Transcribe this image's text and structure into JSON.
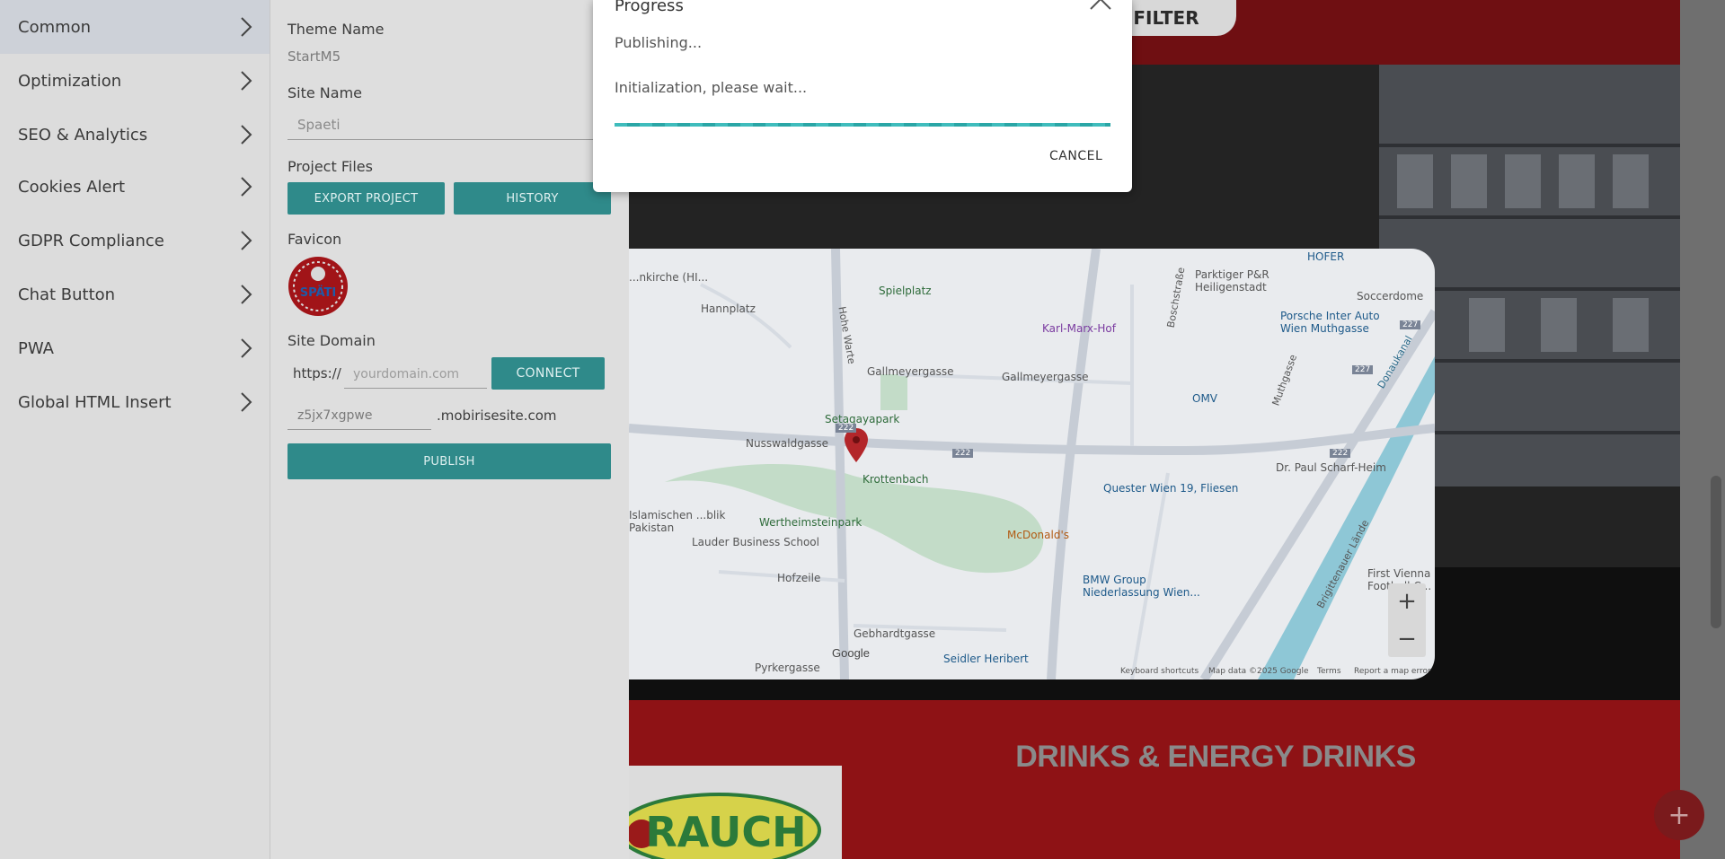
{
  "colors": {
    "accent": "#2f8a8a",
    "progress": "#3fbcbc",
    "brand_red": "#c3181d"
  },
  "sidebar": {
    "items": [
      {
        "label": "Common",
        "icon": "chevron-right-icon"
      },
      {
        "label": "Optimization",
        "icon": "chevron-right-icon"
      },
      {
        "label": "SEO & Analytics",
        "icon": "chevron-right-icon"
      },
      {
        "label": "Cookies Alert",
        "icon": "chevron-right-icon"
      },
      {
        "label": "GDPR Compliance",
        "icon": "chevron-right-icon"
      },
      {
        "label": "Chat Button",
        "icon": "chevron-right-icon"
      },
      {
        "label": "PWA",
        "icon": "chevron-right-icon"
      },
      {
        "label": "Global HTML Insert",
        "icon": "chevron-right-icon"
      }
    ]
  },
  "settings": {
    "theme_name_label": "Theme Name",
    "theme_name_value": "StartM5",
    "site_name_label": "Site Name",
    "site_name_value": "Spaeti",
    "project_files_label": "Project Files",
    "export_label": "EXPORT PROJECT",
    "history_label": "HISTORY",
    "favicon_label": "Favicon",
    "favicon_text": "SPÄTI",
    "site_domain_label": "Site Domain",
    "domain_prefix": "https://",
    "domain_placeholder": "yourdomain.com",
    "connect_label": "CONNECT",
    "subdomain_value": "z5jx7xgpwe",
    "subdomain_suffix": ".mobirisesite.com",
    "publish_label": "PUBLISH"
  },
  "preview": {
    "filter_label": "FILTER",
    "section_title": "DRINKS & ENERGY DRINKS",
    "logo_text": "RAUCH",
    "map": {
      "labels": [
        "Spielplatz",
        "Hannplatz",
        "Gallmeyergasse",
        "Gallmeyergasse",
        "Setagayapark",
        "Nusswaldgasse",
        "Krottenbach",
        "Wertheimsteinpark",
        "Lauder Business School",
        "Hofzeile",
        "Gebhardtgasse",
        "Pyrkergasse",
        "Seidler Heribert",
        "McDonald's",
        "BMW Group Niederlassung Wien...",
        "Quester Wien 19, Fliesen",
        "Dr. Paul Scharf-Heim",
        "OMV",
        "Karl-Marx-Hof",
        "Parktiger P&R Heiligenstadt",
        "HOFER",
        "Porsche Inter Auto Wien Muthgasse",
        "Soccerdome",
        "First Vienna Football C...",
        "Boschstraße",
        "Muthgasse",
        "Hohe Warte",
        "Donaukanal",
        "Brigittenauer Lände",
        "Islamischen ...blik Pakistan",
        "...nkirche (HI..."
      ],
      "road_badges": [
        "222",
        "222",
        "222",
        "227",
        "227"
      ],
      "footer": [
        "Keyboard shortcuts",
        "Map data ©2025 Google",
        "Terms",
        "Report a map error"
      ],
      "google": "Google",
      "zoom_in": "+",
      "zoom_out": "−"
    }
  },
  "dialog": {
    "title": "Progress",
    "status": "Publishing...",
    "message": "Initialization, please wait...",
    "progress_fraction": 1.0,
    "cancel_label": "CANCEL"
  },
  "fab_label": "+"
}
